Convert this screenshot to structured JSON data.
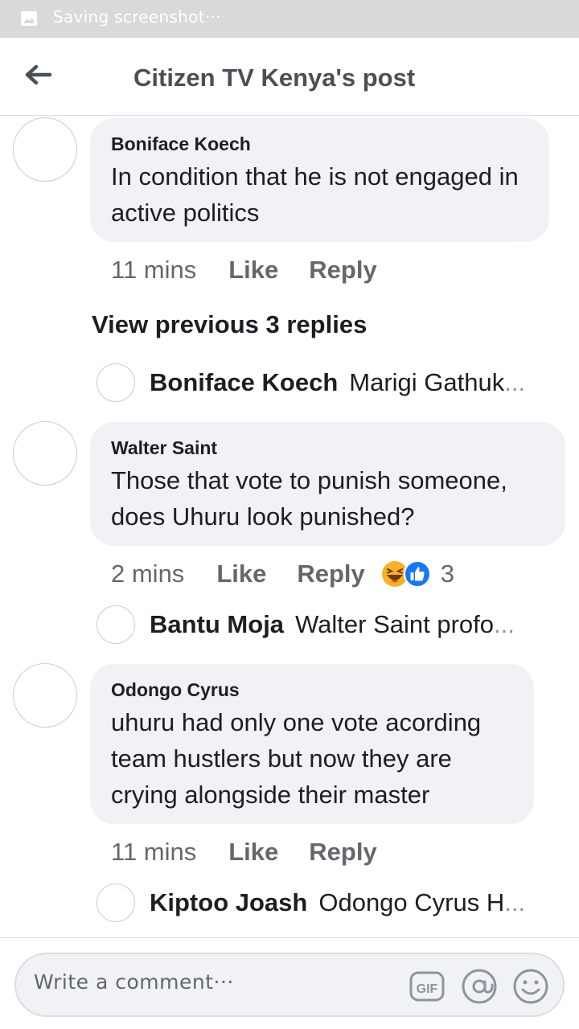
{
  "status_bar": {
    "text": "Saving screenshot···"
  },
  "header": {
    "title": "Citizen TV Kenya's post"
  },
  "comments": [
    {
      "author": "Boniface Koech",
      "text": "In condition that he is not engaged in active politics",
      "time": "11 mins",
      "like": "Like",
      "reply": "Reply"
    },
    {
      "author": "Walter Saint",
      "text": "Those that vote to punish someone, does Uhuru look punished?",
      "time": "2 mins",
      "like": "Like",
      "reply": "Reply",
      "reaction_count": "3",
      "reactions": [
        "haha-icon",
        "like-icon"
      ]
    },
    {
      "author": "Odongo Cyrus",
      "text": "uhuru had only one vote acording team hustlers but now they are crying alongside their master",
      "time": "11 mins",
      "like": "Like",
      "reply": "Reply"
    }
  ],
  "view_previous": "View previous 3 replies",
  "replies": [
    {
      "author": "Boniface Koech",
      "text": "Marigi Gathuk",
      "ellipsis": "..."
    },
    {
      "author": "Bantu Moja",
      "text": "Walter Saint profo",
      "ellipsis": "..."
    },
    {
      "author": "Kiptoo Joash",
      "text": "Odongo Cyrus H",
      "ellipsis": "..."
    }
  ],
  "composer": {
    "placeholder": "Write a comment···",
    "icons": [
      "gif-icon",
      "at-mention-icon",
      "emoji-icon"
    ]
  },
  "colors": {
    "status_bar_bg": "#d9d9d9",
    "bubble_bg": "#f0f2f5",
    "meta_text": "#65676b",
    "like_blue": "#1877f2",
    "haha_yellow": "#f7b125"
  }
}
